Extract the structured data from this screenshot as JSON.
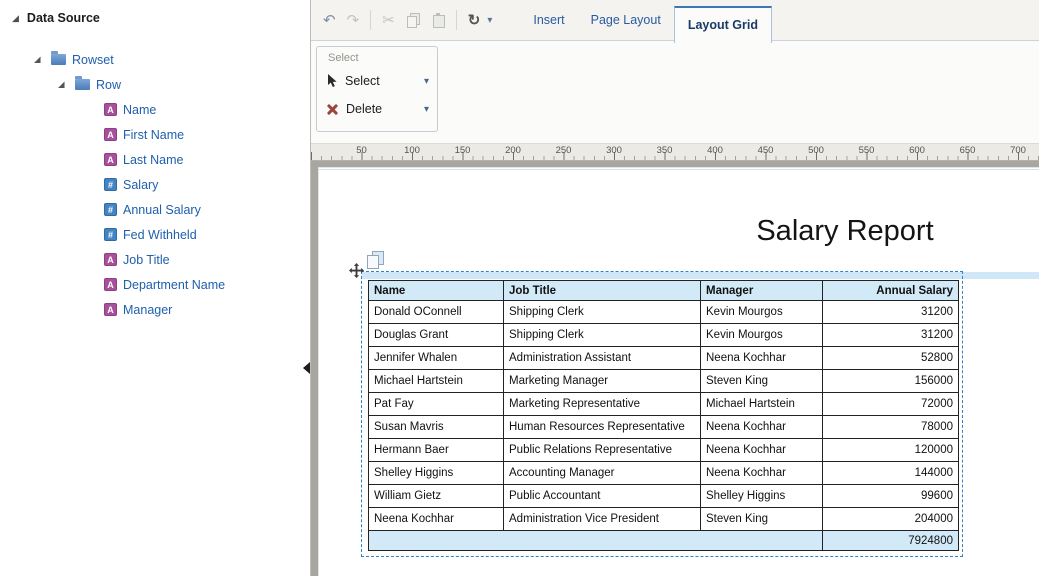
{
  "sidebar": {
    "title": "Data Source"
  },
  "tree": {
    "root_label": "Rowset",
    "row_label": "Row",
    "fields": [
      {
        "label": "Name",
        "icon": "A",
        "type": "text"
      },
      {
        "label": "First Name",
        "icon": "A",
        "type": "text"
      },
      {
        "label": "Last Name",
        "icon": "A",
        "type": "text"
      },
      {
        "label": "Salary",
        "icon": "#",
        "type": "number"
      },
      {
        "label": "Annual Salary",
        "icon": "#",
        "type": "number"
      },
      {
        "label": "Fed Withheld",
        "icon": "#",
        "type": "number"
      },
      {
        "label": "Job Title",
        "icon": "A",
        "type": "text"
      },
      {
        "label": "Department Name",
        "icon": "A",
        "type": "text"
      },
      {
        "label": "Manager",
        "icon": "A",
        "type": "text"
      }
    ]
  },
  "icons": {
    "undo": "↶",
    "redo": "↷",
    "cut": "✂",
    "preview": "↻",
    "dropdown": "▾",
    "disclosure": "◢"
  },
  "toolbar": {
    "tabs": [
      {
        "label": "Insert",
        "active": false
      },
      {
        "label": "Page Layout",
        "active": false
      },
      {
        "label": "Layout Grid",
        "active": true
      }
    ]
  },
  "ribbon": {
    "group_label": "Select",
    "select_label": "Select",
    "delete_label": "Delete"
  },
  "ruler": {
    "labels": [
      "50",
      "100",
      "150",
      "200",
      "250",
      "300",
      "350",
      "400",
      "450",
      "500",
      "550",
      "600",
      "650",
      "700"
    ]
  },
  "report": {
    "title": "Salary Report",
    "table": {
      "headers": [
        "Name",
        "Job Title",
        "Manager",
        "Annual Salary"
      ],
      "rows": [
        {
          "name": "Donald OConnell",
          "job_title": "Shipping Clerk",
          "manager": "Kevin Mourgos",
          "annual_salary": "31200"
        },
        {
          "name": "Douglas Grant",
          "job_title": "Shipping Clerk",
          "manager": "Kevin Mourgos",
          "annual_salary": "31200"
        },
        {
          "name": "Jennifer Whalen",
          "job_title": "Administration Assistant",
          "manager": "Neena Kochhar",
          "annual_salary": "52800"
        },
        {
          "name": "Michael Hartstein",
          "job_title": "Marketing Manager",
          "manager": "Steven King",
          "annual_salary": "156000"
        },
        {
          "name": "Pat Fay",
          "job_title": "Marketing Representative",
          "manager": "Michael Hartstein",
          "annual_salary": "72000"
        },
        {
          "name": "Susan Mavris",
          "job_title": "Human Resources Representative",
          "manager": "Neena Kochhar",
          "annual_salary": "78000"
        },
        {
          "name": "Hermann Baer",
          "job_title": "Public Relations Representative",
          "manager": "Neena Kochhar",
          "annual_salary": "120000"
        },
        {
          "name": "Shelley Higgins",
          "job_title": "Accounting Manager",
          "manager": "Neena Kochhar",
          "annual_salary": "144000"
        },
        {
          "name": "William Gietz",
          "job_title": "Public Accountant",
          "manager": "Shelley Higgins",
          "annual_salary": "99600"
        },
        {
          "name": "Neena Kochhar",
          "job_title": "Administration Vice President",
          "manager": "Steven King",
          "annual_salary": "204000"
        }
      ],
      "total": "7924800"
    }
  },
  "colors": {
    "selection_blue": "#2f83c5",
    "table_header_fill": "#d2eaf7",
    "text_field_icon": "#a8509c",
    "number_field_icon": "#4384c4"
  }
}
